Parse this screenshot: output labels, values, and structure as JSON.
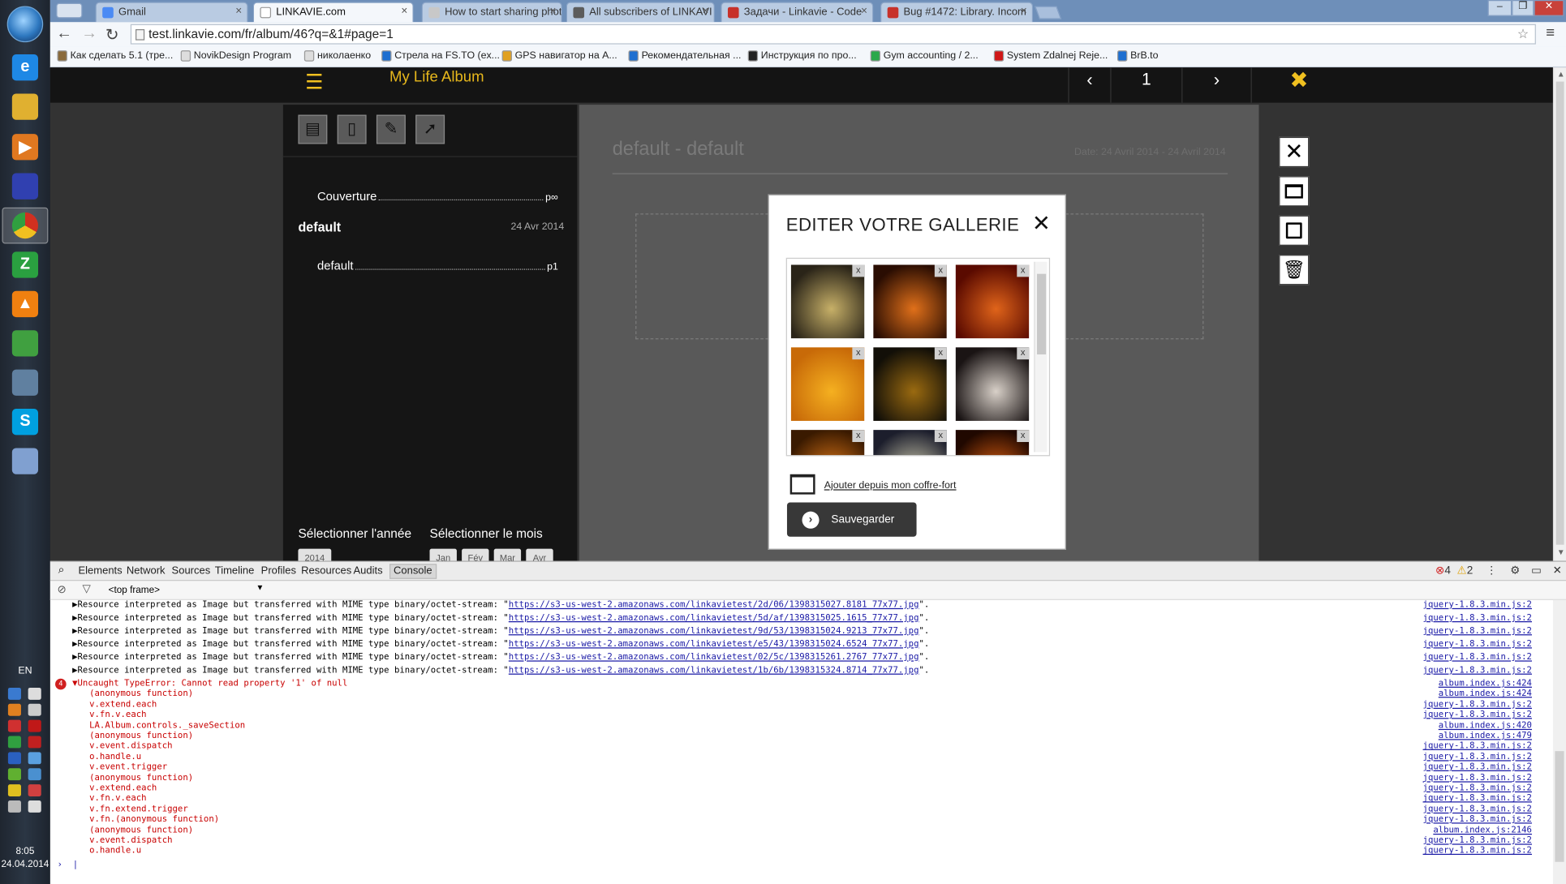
{
  "browser": {
    "tabs": [
      {
        "label": "Gmail",
        "fav": "#4a8af4"
      },
      {
        "label": "LINKAVIE.com",
        "fav": "#ffffff"
      },
      {
        "label": "How to start sharing phot",
        "fav": "#c8c8c8"
      },
      {
        "label": "All subscribers of LINKAVI",
        "fav": "#5c5c5c"
      },
      {
        "label": "Задачи - Linkavie - Code",
        "fav": "#c7312a"
      },
      {
        "label": "Bug #1472: Library. Incom",
        "fav": "#c7312a"
      }
    ],
    "url": "test.linkavie.com/fr/album/46?q=&1#page=1",
    "bookmarks": [
      {
        "label": "Как сделать 5.1 (тре...",
        "color": "#8a6a3c"
      },
      {
        "label": "NovikDesign Program",
        "color": "#dddddd"
      },
      {
        "label": "николаенко",
        "color": "#dddddd"
      },
      {
        "label": "Стрела на FS.TO (ex...",
        "color": "#1e6fd0"
      },
      {
        "label": "GPS навигатор на А...",
        "color": "#e0a020"
      },
      {
        "label": "Рекомендательная ...",
        "color": "#1e6fd0"
      },
      {
        "label": "Инструкция по про...",
        "color": "#222222"
      },
      {
        "label": "Gym accounting / 2...",
        "color": "#2aa84a"
      },
      {
        "label": "System Zdalnej Reje...",
        "color": "#d01818"
      },
      {
        "label": "BrB.to",
        "color": "#1e6fd0"
      }
    ]
  },
  "app": {
    "album_title": "My Life Album",
    "page_number": "1",
    "nav_prev": "‹",
    "nav_next": "›",
    "toc": {
      "cover_label": "Couverture",
      "cover_page": "p∞",
      "section_title": "default",
      "section_date": "24 Avr 2014",
      "item_label": "default",
      "item_page": "p1"
    },
    "select_year_label": "Sélectionner l'année",
    "select_month_label": "Sélectionner le mois",
    "year_chip": "2014",
    "month_chips": [
      "Jan",
      "Fév",
      "Mar",
      "Avr"
    ],
    "main_title": "default - default",
    "main_date": "Date: 24 Avril 2014 - 24 Avril 2014"
  },
  "modal": {
    "title": "EDITER VOTRE GALLERIE",
    "delete_label": "x",
    "add_link": "Ajouter depuis mon coffre-fort",
    "save_label": "Sauvegarder",
    "thumbnails": [
      {
        "c1": "#2a2418",
        "c2": "#c7b068"
      },
      {
        "c1": "#2a0d02",
        "c2": "#e0701a"
      },
      {
        "c1": "#5a0a00",
        "c2": "#e0641a"
      },
      {
        "c1": "#c86a08",
        "c2": "#f5b020"
      },
      {
        "c1": "#120f08",
        "c2": "#9a6a10"
      },
      {
        "c1": "#1a1414",
        "c2": "#d8d0c8"
      },
      {
        "c1": "#3a1a00",
        "c2": "#e07818"
      },
      {
        "c1": "#1c1e2c",
        "c2": "#d0ccb0"
      },
      {
        "c1": "#200800",
        "c2": "#e06010"
      }
    ]
  },
  "devtools": {
    "tabs": [
      "Elements",
      "Network",
      "Sources",
      "Timeline",
      "Profiles",
      "Resources",
      "Audits",
      "Console"
    ],
    "errors": "4",
    "warnings": "2",
    "frame": "<top frame>",
    "resource_lines": [
      {
        "text": "Resource interpreted as Image but transferred with MIME type binary/octet-stream: \"",
        "url": "https://s3-us-west-2.amazonaws.com/linkavietest/2d/06/1398315027.8181_77x77.jpg",
        "tail": "\".",
        "src": "jquery-1.8.3.min.js:2"
      },
      {
        "text": "Resource interpreted as Image but transferred with MIME type binary/octet-stream: \"",
        "url": "https://s3-us-west-2.amazonaws.com/linkavietest/5d/af/1398315025.1615_77x77.jpg",
        "tail": "\".",
        "src": "jquery-1.8.3.min.js:2"
      },
      {
        "text": "Resource interpreted as Image but transferred with MIME type binary/octet-stream: \"",
        "url": "https://s3-us-west-2.amazonaws.com/linkavietest/9d/53/1398315024.9213_77x77.jpg",
        "tail": "\".",
        "src": "jquery-1.8.3.min.js:2"
      },
      {
        "text": "Resource interpreted as Image but transferred with MIME type binary/octet-stream: \"",
        "url": "https://s3-us-west-2.amazonaws.com/linkavietest/e5/43/1398315024.6524_77x77.jpg",
        "tail": "\".",
        "src": "jquery-1.8.3.min.js:2"
      },
      {
        "text": "Resource interpreted as Image but transferred with MIME type binary/octet-stream: \"",
        "url": "https://s3-us-west-2.amazonaws.com/linkavietest/02/5c/1398315261.2767_77x77.jpg",
        "tail": "\".",
        "src": "jquery-1.8.3.min.js:2"
      },
      {
        "text": "Resource interpreted as Image but transferred with MIME type binary/octet-stream: \"",
        "url": "https://s3-us-west-2.amazonaws.com/linkavietest/1b/6b/1398315324.8714_77x77.jpg",
        "tail": "\".",
        "src": "jquery-1.8.3.min.js:2"
      }
    ],
    "error_count_badge": "4",
    "error_message": "Uncaught TypeError: Cannot read property '1' of null",
    "error_src": "album.index.js:424",
    "stack": [
      {
        "fn": "(anonymous function)",
        "src": "album.index.js:424"
      },
      {
        "fn": "v.extend.each",
        "src": "jquery-1.8.3.min.js:2"
      },
      {
        "fn": "v.fn.v.each",
        "src": "jquery-1.8.3.min.js:2"
      },
      {
        "fn": "LA.Album.controls._saveSection",
        "src": "album.index.js:420"
      },
      {
        "fn": "(anonymous function)",
        "src": "album.index.js:479"
      },
      {
        "fn": "v.event.dispatch",
        "src": "jquery-1.8.3.min.js:2"
      },
      {
        "fn": "o.handle.u",
        "src": "jquery-1.8.3.min.js:2"
      },
      {
        "fn": "v.event.trigger",
        "src": "jquery-1.8.3.min.js:2"
      },
      {
        "fn": "(anonymous function)",
        "src": "jquery-1.8.3.min.js:2"
      },
      {
        "fn": "v.extend.each",
        "src": "jquery-1.8.3.min.js:2"
      },
      {
        "fn": "v.fn.v.each",
        "src": "jquery-1.8.3.min.js:2"
      },
      {
        "fn": "v.fn.extend.trigger",
        "src": "jquery-1.8.3.min.js:2"
      },
      {
        "fn": "v.fn.(anonymous function)",
        "src": "jquery-1.8.3.min.js:2"
      },
      {
        "fn": "(anonymous function)",
        "src": "album.index.js:2146"
      },
      {
        "fn": "v.event.dispatch",
        "src": "jquery-1.8.3.min.js:2"
      },
      {
        "fn": "o.handle.u",
        "src": "jquery-1.8.3.min.js:2"
      }
    ]
  },
  "taskbar": {
    "apps": [
      {
        "name": "ie-icon",
        "color": "#1e88e5",
        "glyph": "e"
      },
      {
        "name": "explorer-icon",
        "color": "#e0b030",
        "glyph": ""
      },
      {
        "name": "media-player-icon",
        "color": "#e07820",
        "glyph": "▶"
      },
      {
        "name": "save-app-icon",
        "color": "#3040b0",
        "glyph": ""
      },
      {
        "name": "chrome-icon",
        "color": "#d03020",
        "glyph": ""
      },
      {
        "name": "green-app-icon",
        "color": "#2aa040",
        "glyph": "Z"
      },
      {
        "name": "vlc-icon",
        "color": "#f08010",
        "glyph": "▲"
      },
      {
        "name": "tools-app-icon",
        "color": "#40a040",
        "glyph": ""
      },
      {
        "name": "monitor-app-icon",
        "color": "#6080a0",
        "glyph": ""
      },
      {
        "name": "skype-icon",
        "color": "#00a0e0",
        "glyph": "S"
      },
      {
        "name": "paint-icon",
        "color": "#80a0d0",
        "glyph": ""
      }
    ],
    "language": "EN",
    "time": "8:05",
    "date": "24.04.2014"
  }
}
